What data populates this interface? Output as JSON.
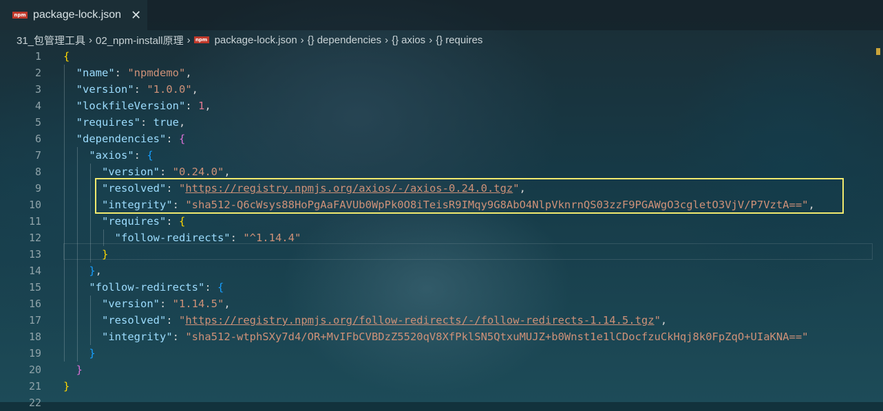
{
  "tab": {
    "badge": "npm",
    "title": "package-lock.json",
    "close": "✕"
  },
  "breadcrumb": {
    "items": [
      "31_包管理工具",
      "02_npm-install原理",
      "package-lock.json",
      "dependencies",
      "axios",
      "requires"
    ],
    "braces": "{}"
  },
  "lines": [
    {
      "n": "1",
      "tokens": [
        {
          "t": "{",
          "c": "b1"
        }
      ]
    },
    {
      "n": "2",
      "tokens": [
        {
          "t": "  "
        },
        {
          "t": "\"name\"",
          "c": "k"
        },
        {
          "t": ": "
        },
        {
          "t": "\"npmdemo\"",
          "c": "s"
        },
        {
          "t": ","
        }
      ]
    },
    {
      "n": "3",
      "tokens": [
        {
          "t": "  "
        },
        {
          "t": "\"version\"",
          "c": "k"
        },
        {
          "t": ": "
        },
        {
          "t": "\"1.0.0\"",
          "c": "s"
        },
        {
          "t": ","
        }
      ]
    },
    {
      "n": "4",
      "tokens": [
        {
          "t": "  "
        },
        {
          "t": "\"lockfileVersion\"",
          "c": "k"
        },
        {
          "t": ": "
        },
        {
          "t": "1",
          "c": "n"
        },
        {
          "t": ","
        }
      ]
    },
    {
      "n": "5",
      "tokens": [
        {
          "t": "  "
        },
        {
          "t": "\"requires\"",
          "c": "k"
        },
        {
          "t": ": "
        },
        {
          "t": "true",
          "c": "k"
        },
        {
          "t": ","
        }
      ]
    },
    {
      "n": "6",
      "tokens": [
        {
          "t": "  "
        },
        {
          "t": "\"dependencies\"",
          "c": "k"
        },
        {
          "t": ": "
        },
        {
          "t": "{",
          "c": "b2"
        }
      ]
    },
    {
      "n": "7",
      "tokens": [
        {
          "t": "    "
        },
        {
          "t": "\"axios\"",
          "c": "k"
        },
        {
          "t": ": "
        },
        {
          "t": "{",
          "c": "b3"
        }
      ]
    },
    {
      "n": "8",
      "tokens": [
        {
          "t": "      "
        },
        {
          "t": "\"version\"",
          "c": "k"
        },
        {
          "t": ": "
        },
        {
          "t": "\"0.24.0\"",
          "c": "s"
        },
        {
          "t": ","
        }
      ]
    },
    {
      "n": "9",
      "tokens": [
        {
          "t": "      "
        },
        {
          "t": "\"resolved\"",
          "c": "k"
        },
        {
          "t": ": "
        },
        {
          "t": "\"",
          "c": "s"
        },
        {
          "t": "https://registry.npmjs.org/axios/-/axios-0.24.0.tgz",
          "c": "s u"
        },
        {
          "t": "\"",
          "c": "s"
        },
        {
          "t": ","
        }
      ]
    },
    {
      "n": "10",
      "tokens": [
        {
          "t": "      "
        },
        {
          "t": "\"integrity\"",
          "c": "k"
        },
        {
          "t": ": "
        },
        {
          "t": "\"sha512-Q6cWsys88HoPgAaFAVUb0WpPk0O8iTeisR9IMqy9G8AbO4NlpVknrnQS03zzF9PGAWgO3cgletO3VjV/P7VztA==\"",
          "c": "s"
        },
        {
          "t": ","
        }
      ]
    },
    {
      "n": "11",
      "tokens": [
        {
          "t": "      "
        },
        {
          "t": "\"requires\"",
          "c": "k"
        },
        {
          "t": ": "
        },
        {
          "t": "{",
          "c": "b1"
        }
      ]
    },
    {
      "n": "12",
      "tokens": [
        {
          "t": "        "
        },
        {
          "t": "\"follow-redirects\"",
          "c": "k"
        },
        {
          "t": ": "
        },
        {
          "t": "\"^1.14.4\"",
          "c": "s"
        }
      ]
    },
    {
      "n": "13",
      "tokens": [
        {
          "t": "      "
        },
        {
          "t": "}",
          "c": "b1"
        }
      ]
    },
    {
      "n": "14",
      "tokens": [
        {
          "t": "    "
        },
        {
          "t": "}",
          "c": "b3"
        },
        {
          "t": ","
        }
      ]
    },
    {
      "n": "15",
      "tokens": [
        {
          "t": "    "
        },
        {
          "t": "\"follow-redirects\"",
          "c": "k"
        },
        {
          "t": ": "
        },
        {
          "t": "{",
          "c": "b3"
        }
      ]
    },
    {
      "n": "16",
      "tokens": [
        {
          "t": "      "
        },
        {
          "t": "\"version\"",
          "c": "k"
        },
        {
          "t": ": "
        },
        {
          "t": "\"1.14.5\"",
          "c": "s"
        },
        {
          "t": ","
        }
      ]
    },
    {
      "n": "17",
      "tokens": [
        {
          "t": "      "
        },
        {
          "t": "\"resolved\"",
          "c": "k"
        },
        {
          "t": ": "
        },
        {
          "t": "\"",
          "c": "s"
        },
        {
          "t": "https://registry.npmjs.org/follow-redirects/-/follow-redirects-1.14.5.tgz",
          "c": "s u"
        },
        {
          "t": "\"",
          "c": "s"
        },
        {
          "t": ","
        }
      ]
    },
    {
      "n": "18",
      "tokens": [
        {
          "t": "      "
        },
        {
          "t": "\"integrity\"",
          "c": "k"
        },
        {
          "t": ": "
        },
        {
          "t": "\"sha512-wtphSXy7d4/OR+MvIFbCVBDzZ5520qV8XfPklSN5QtxuMUJZ+b0Wnst1e1lCDocfzuCkHqj8k0FpZqO+UIaKNA==\"",
          "c": "s"
        }
      ]
    },
    {
      "n": "19",
      "tokens": [
        {
          "t": "    "
        },
        {
          "t": "}",
          "c": "b3"
        }
      ]
    },
    {
      "n": "20",
      "tokens": [
        {
          "t": "  "
        },
        {
          "t": "}",
          "c": "b2"
        }
      ]
    },
    {
      "n": "21",
      "tokens": [
        {
          "t": "}",
          "c": "b1"
        }
      ]
    },
    {
      "n": "22",
      "tokens": []
    }
  ]
}
